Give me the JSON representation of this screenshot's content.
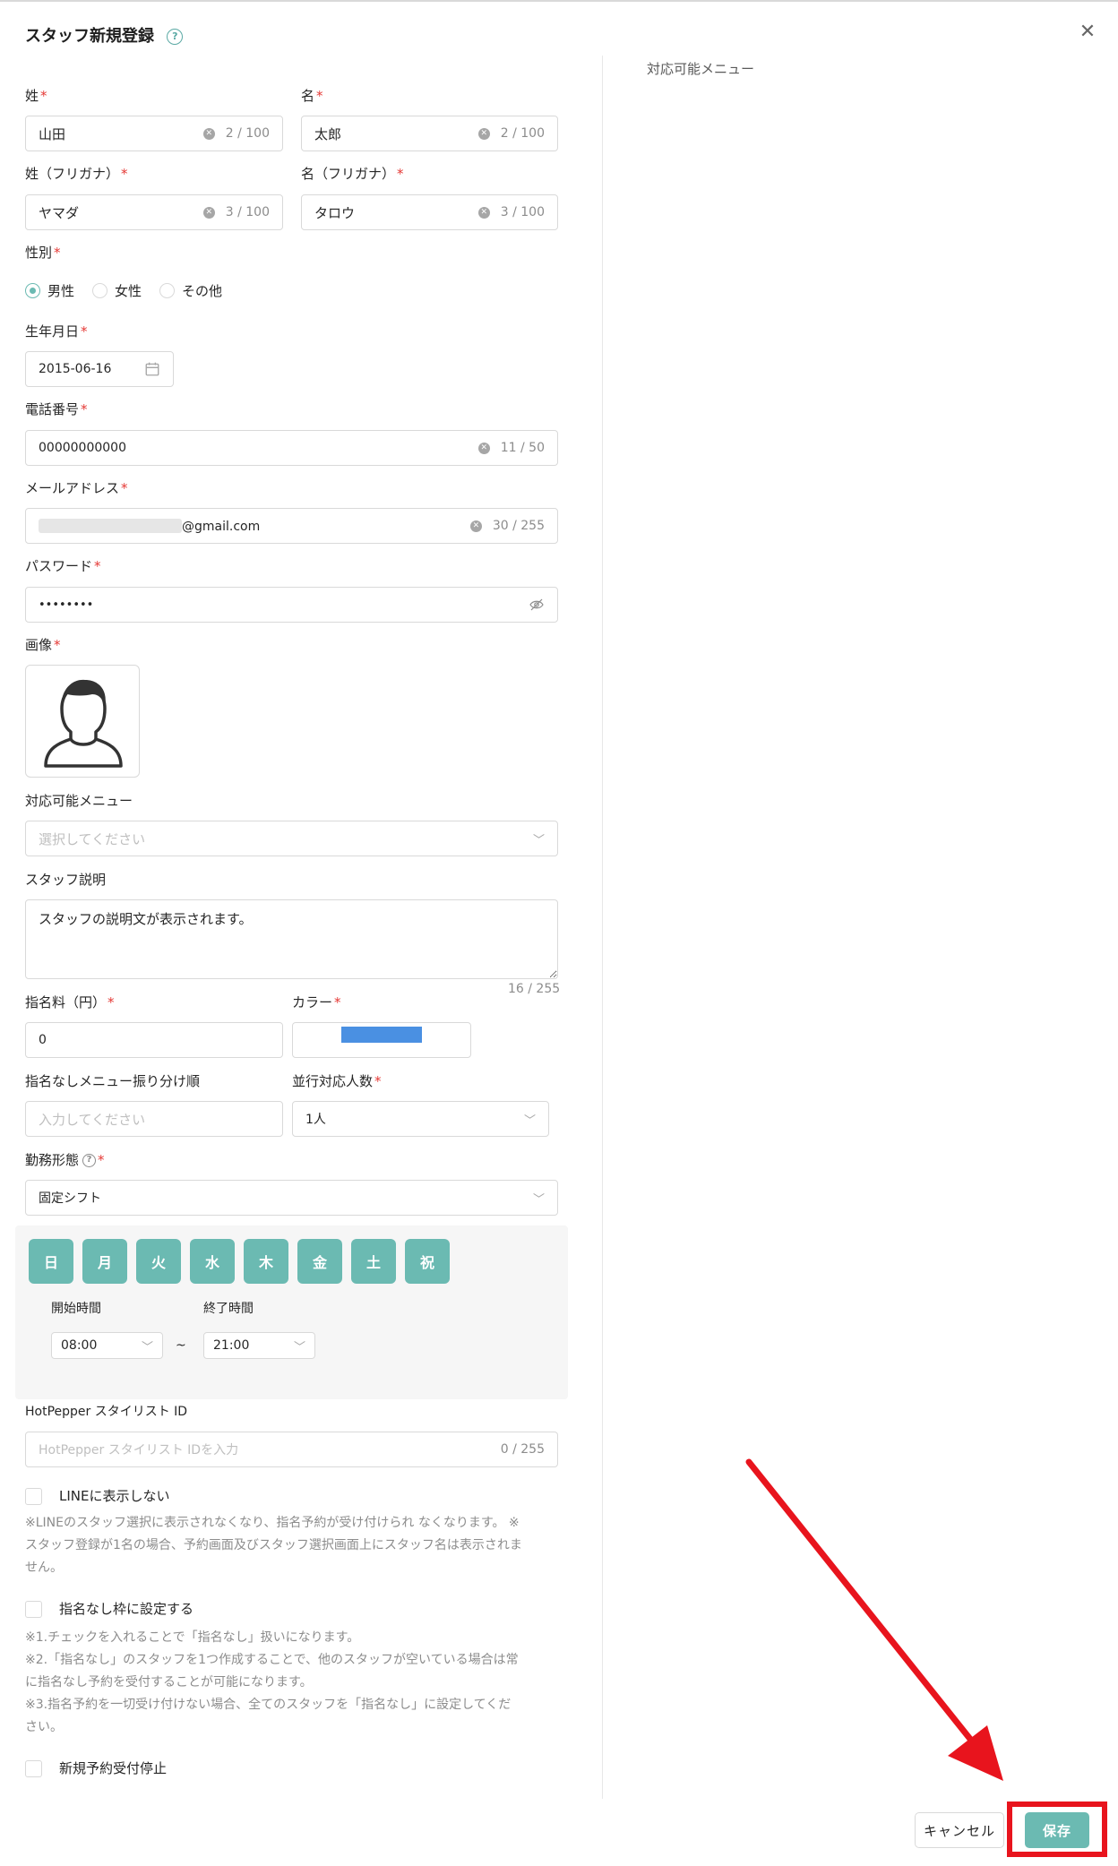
{
  "colors": {
    "accent": "#6bbab2",
    "required": "#e53935",
    "staff_color": "#4a90e2",
    "annotation": "#e8141d"
  },
  "dialog": {
    "title": "スタッフ新規登録",
    "help_glyph": "?",
    "close_glyph": "✕"
  },
  "required_mark": "*",
  "right_panel": {
    "label": "対応可能メニュー"
  },
  "fields": {
    "last_name": {
      "label": "姓",
      "value": "山田",
      "count": "2 / 100"
    },
    "first_name": {
      "label": "名",
      "value": "太郎",
      "count": "2 / 100"
    },
    "last_kana": {
      "label": "姓（フリガナ）",
      "value": "ヤマダ",
      "count": "3 / 100"
    },
    "first_kana": {
      "label": "名（フリガナ）",
      "value": "タロウ",
      "count": "3 / 100"
    },
    "gender": {
      "label": "性別",
      "options": [
        "男性",
        "女性",
        "その他"
      ],
      "selected": "男性"
    },
    "birthday": {
      "label": "生年月日",
      "value": "2015-06-16"
    },
    "phone": {
      "label": "電話番号",
      "value": "00000000000",
      "count": "11 / 50"
    },
    "email": {
      "label": "メールアドレス",
      "value": "@gmail.com",
      "count": "30 / 255"
    },
    "password": {
      "label": "パスワード",
      "value": "••••••••"
    },
    "image": {
      "label": "画像"
    },
    "menus": {
      "label": "対応可能メニュー",
      "placeholder": "選択してください"
    },
    "description": {
      "label": "スタッフ説明",
      "value": "スタッフの説明文が表示されます。",
      "count": "16 / 255"
    },
    "nomination_fee": {
      "label": "指名料（円）",
      "value": "0"
    },
    "color": {
      "label": "カラー",
      "value": "#4a90e2"
    },
    "assign_order": {
      "label": "指名なしメニュー振り分け順",
      "placeholder": "入力してください"
    },
    "concurrent": {
      "label": "並行対応人数",
      "value": "1人"
    },
    "work_type": {
      "label": "勤務形態",
      "value": "固定シフト"
    },
    "hotpepper": {
      "label": "HotPepper スタイリスト ID",
      "placeholder": "HotPepper スタイリスト IDを入力",
      "count": "0 / 255"
    }
  },
  "shift": {
    "days": [
      "日",
      "月",
      "火",
      "水",
      "木",
      "金",
      "土",
      "祝"
    ],
    "start_label": "開始時間",
    "start_value": "08:00",
    "end_label": "終了時間",
    "end_value": "21:00",
    "separator": "~"
  },
  "options": {
    "hide_line": {
      "label": "LINEに表示しない",
      "note": [
        "※LINEのスタッフ選択に表示されなくなり、指名予約が受け付けられ なくなります。 ※",
        "スタッフ登録が1名の場合、予約画面及びスタッフ選択画面上にスタッフ名は表示されま",
        "せん。"
      ]
    },
    "no_nomination": {
      "label": "指名なし枠に設定する",
      "note": [
        "※1.チェックを入れることで「指名なし」扱いになります。",
        "※2.「指名なし」のスタッフを1つ作成することで、他のスタッフが空いている場合は常",
        "に指名なし予約を受付することが可能になります。",
        "※3.指名予約を一切受け付けない場合、全てのスタッフを「指名なし」に設定してくだ",
        "さい。"
      ]
    },
    "stop_booking": {
      "label": "新規予約受付停止"
    }
  },
  "buttons": {
    "cancel": "キャンセル",
    "save": "保存"
  }
}
